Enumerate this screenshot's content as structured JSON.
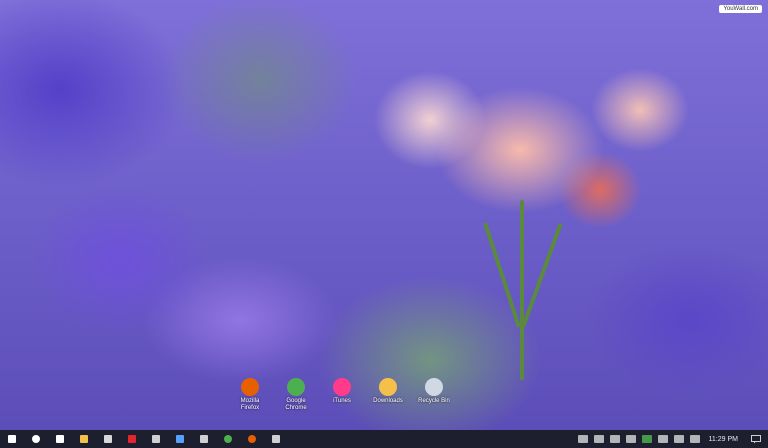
{
  "wallpaper": {
    "watermark": "YouWall.com"
  },
  "desktop_icons": [
    {
      "label": "Mozilla\nFirefox",
      "icon": "firefox-icon",
      "color": "#e66000"
    },
    {
      "label": "Google\nChrome",
      "icon": "chrome-icon",
      "color": "#4caf50"
    },
    {
      "label": "iTunes",
      "icon": "itunes-icon",
      "color": "#ff3b8a"
    },
    {
      "label": "Downloads",
      "icon": "downloads-folder-icon",
      "color": "#f5c04a"
    },
    {
      "label": "Recycle Bin",
      "icon": "recycle-bin-icon",
      "color": "#cfd8e3"
    }
  ],
  "taskbar": {
    "items": [
      {
        "icon": "start-icon",
        "color": "#ffffff"
      },
      {
        "icon": "cortana-icon",
        "color": "#ffffff"
      },
      {
        "icon": "task-view-icon",
        "color": "#ffffff"
      },
      {
        "icon": "file-explorer-icon",
        "color": "#f5c04a"
      },
      {
        "icon": "tile-app-icon",
        "color": "#d7d7d7"
      },
      {
        "icon": "adobe-icon",
        "color": "#e2262b"
      },
      {
        "icon": "puzzle-icon",
        "color": "#d0d0d0"
      },
      {
        "icon": "window-app-icon",
        "color": "#56a0ff"
      },
      {
        "icon": "store-icon",
        "color": "#d0d0d0"
      },
      {
        "icon": "chrome-icon",
        "color": "#4caf50"
      },
      {
        "icon": "firefox-icon",
        "color": "#e66000"
      },
      {
        "icon": "media-icon",
        "color": "#d0d0d0"
      }
    ],
    "tray": [
      {
        "icon": "show-hidden-icons",
        "color": "#d0d0d0"
      },
      {
        "icon": "volume-icon",
        "color": "#d0d0d0"
      },
      {
        "icon": "network-icon",
        "color": "#d0d0d0"
      },
      {
        "icon": "monitor-icon",
        "color": "#d0d0d0"
      },
      {
        "icon": "green-app-icon",
        "color": "#4caf50"
      },
      {
        "icon": "wifi-icon",
        "color": "#d0d0d0"
      },
      {
        "icon": "language-icon",
        "color": "#d0d0d0"
      },
      {
        "icon": "keyboard-icon",
        "color": "#d0d0d0"
      }
    ],
    "clock": "11:29 PM",
    "notifications_icon": "action-center-icon"
  }
}
